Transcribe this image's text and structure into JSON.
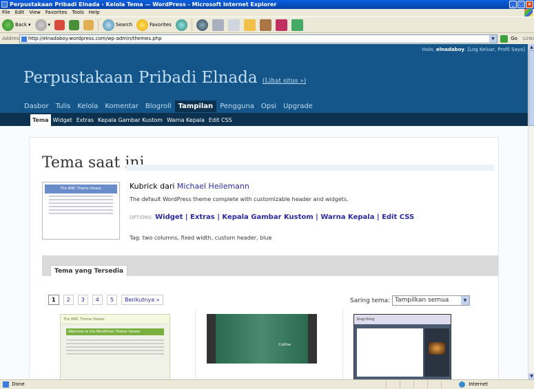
{
  "window": {
    "title": "Perpustakaan Pribadi Elnada › Kelola Tema — WordPress - Microsoft Internet Explorer",
    "buttons": [
      "_",
      "□",
      "×"
    ]
  },
  "menu": [
    "File",
    "Edit",
    "View",
    "Favorites",
    "Tools",
    "Help"
  ],
  "toolbar": {
    "back": "Back",
    "search": "Search",
    "favorites": "Favorites"
  },
  "address": {
    "label": "Address",
    "url": "http://elnadaboy.wordpress.com/wp-admin/themes.php",
    "go": "Go",
    "links": "Links"
  },
  "wp": {
    "user_greeting": "Halo, ",
    "username": "elnadaboy",
    "user_links": ". [Log Keluar, Profil Saya]",
    "blog_title": "Perpustakaan Pribadi Elnada",
    "visit_site": "(Lihat situs »)",
    "main_menu": [
      "Dasbor",
      "Tulis",
      "Kelola",
      "Komentar",
      "Blogroll",
      "Tampilan",
      "Pengguna",
      "Opsi",
      "Upgrade"
    ],
    "main_active": "Tampilan",
    "sub_menu": [
      "Tema",
      "Widget",
      "Extras",
      "Kepala Gambar Kustom",
      "Warna Kepala",
      "Edit CSS"
    ],
    "sub_active": "Tema"
  },
  "current_theme": {
    "heading": "Tema saat ini",
    "screenshot_title": "The WRC Theme Viewer",
    "name_prefix": "Kubrick dari ",
    "author": "Michael Heilemann",
    "description": "The default WordPress theme complete with customizable header and widgets.",
    "options_label": "OPTIONS:",
    "options": "Widget | Extras | Kepala Gambar Kustom | Warna Kepala | Edit CSS",
    "tags": "Tag: two columns, fixed width, custom header, blue"
  },
  "available": {
    "tab_label": "Tema yang Tersedia",
    "pages": [
      "1",
      "2",
      "3",
      "4",
      "5"
    ],
    "current_page": "1",
    "next": "Berikutnya »",
    "filter_label": "Saring tema:",
    "filter_value": "Tampilkan semua",
    "thumbs": [
      {
        "head": "The WRC Theme Viewer",
        "banner": "Welcome to the WordPress Theme Viewer"
      },
      {
        "label": "Cutline"
      },
      {
        "head": "blog-thing"
      }
    ]
  },
  "status": {
    "left": "Done",
    "zone": "Internet"
  }
}
